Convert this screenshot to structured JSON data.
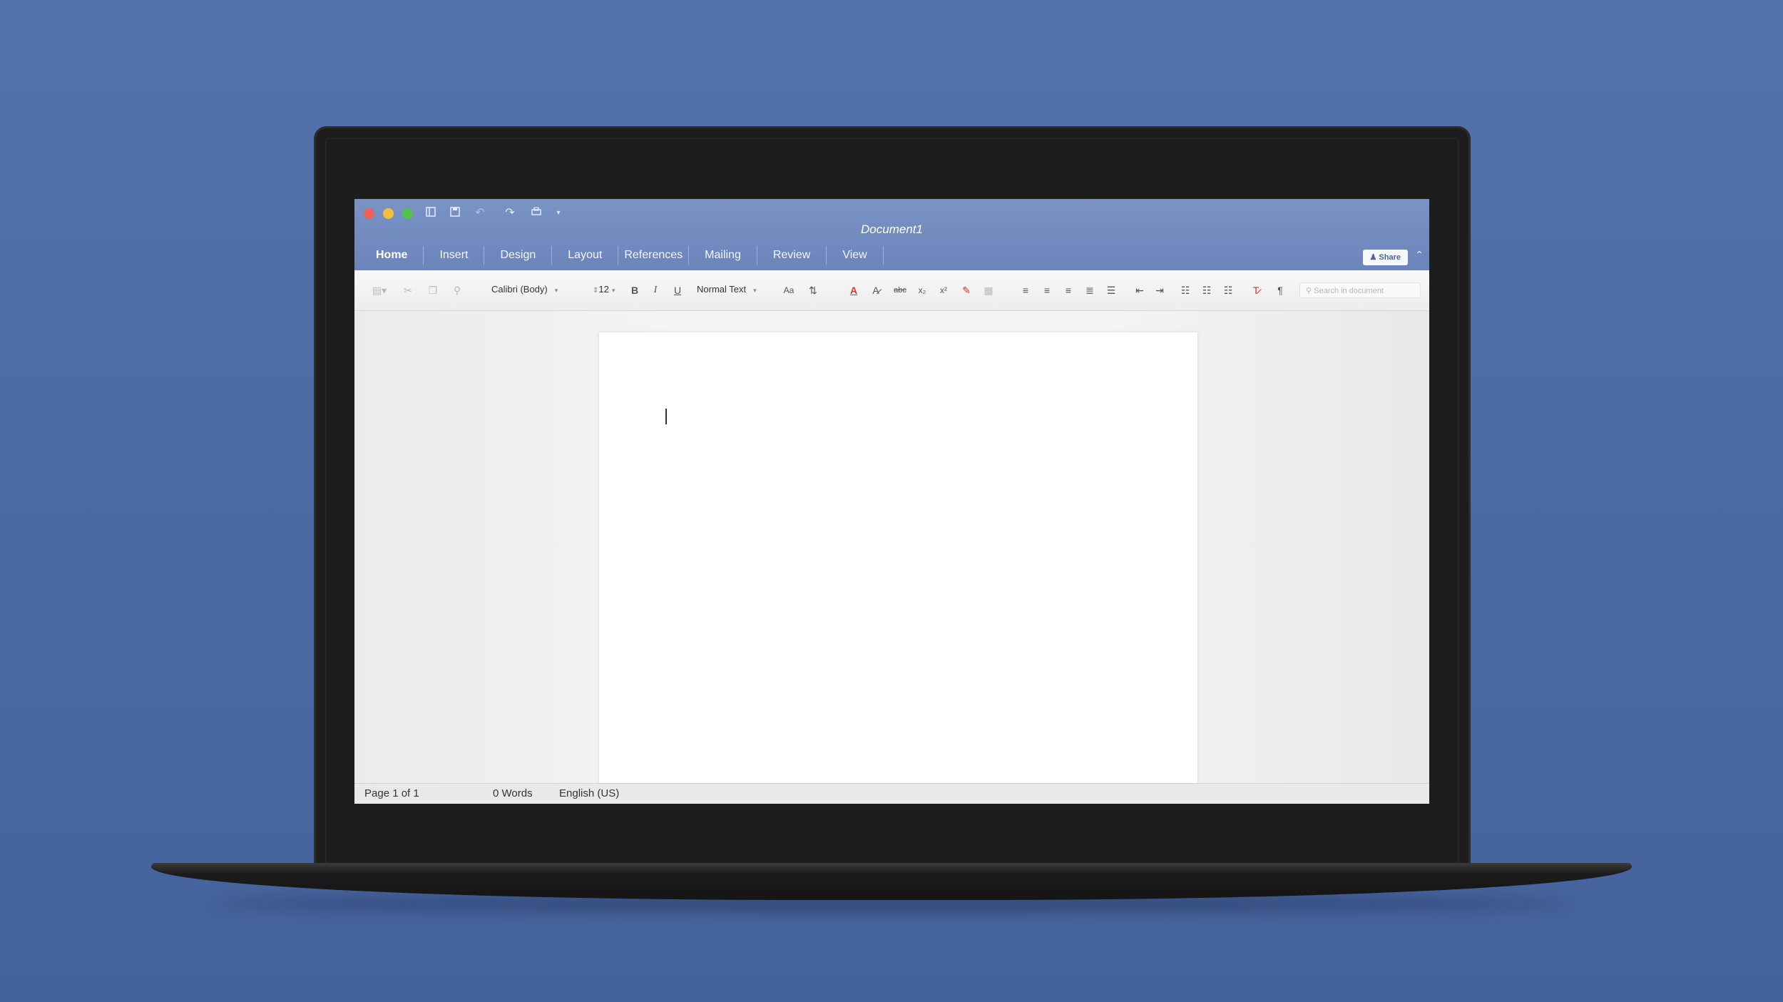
{
  "window": {
    "title": "Document1",
    "quick_access": [
      "sidebar-icon",
      "save-icon",
      "undo-icon",
      "redo-icon",
      "print-icon",
      "customize-icon"
    ]
  },
  "tabs": [
    {
      "label": "Home",
      "active": true
    },
    {
      "label": "Insert"
    },
    {
      "label": "Design"
    },
    {
      "label": "Layout"
    },
    {
      "label": "References"
    },
    {
      "label": "Mailing"
    },
    {
      "label": "Review"
    },
    {
      "label": "View"
    }
  ],
  "share": {
    "label": "Share"
  },
  "ribbon": {
    "font_name": "Calibri (Body)",
    "font_size": "12",
    "style": "Normal Text",
    "bold": "B",
    "italic": "I",
    "underline": "U",
    "change_case": "Aa",
    "strikethrough": "abc",
    "subscript": "x₂",
    "superscript": "x²",
    "pilcrow": "¶",
    "search_placeholder": "Search in document"
  },
  "status": {
    "page": "Page 1 of 1",
    "words": "0 Words",
    "language": "English (US)"
  },
  "colors": {
    "accent": "#6b85bb",
    "background": "#4b69a2"
  }
}
